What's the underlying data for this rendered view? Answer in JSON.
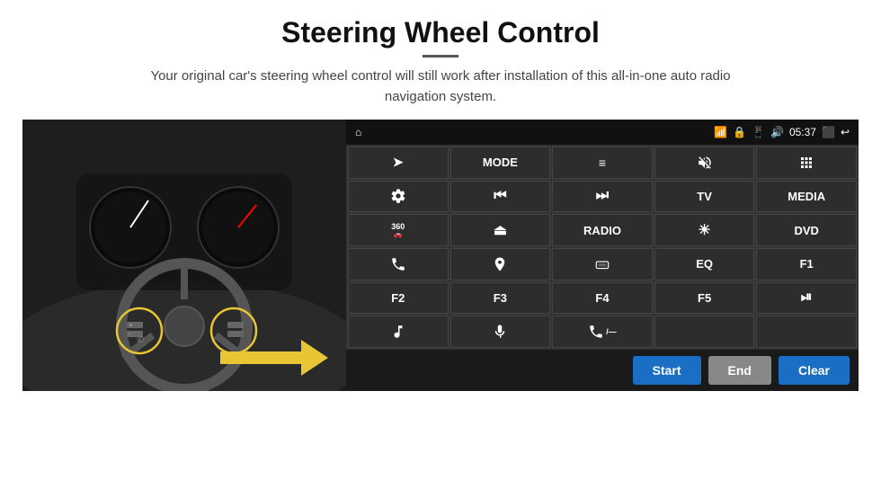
{
  "page": {
    "title": "Steering Wheel Control",
    "subtitle": "Your original car's steering wheel control will still work after installation of this all-in-one auto radio navigation system."
  },
  "status_bar": {
    "time": "05:37",
    "home_icon": "⌂"
  },
  "grid": [
    [
      {
        "type": "icon",
        "icon": "navigate",
        "sym": "➤"
      },
      {
        "type": "text",
        "label": "MODE"
      },
      {
        "type": "icon",
        "icon": "list",
        "sym": "≡"
      },
      {
        "type": "icon",
        "icon": "mute",
        "sym": "🔇"
      },
      {
        "type": "icon",
        "icon": "apps",
        "sym": "⊞"
      }
    ],
    [
      {
        "type": "icon",
        "icon": "settings",
        "sym": "⚙"
      },
      {
        "type": "icon",
        "icon": "rewind",
        "sym": "⏮"
      },
      {
        "type": "icon",
        "icon": "forward",
        "sym": "⏭"
      },
      {
        "type": "text",
        "label": "TV"
      },
      {
        "type": "text",
        "label": "MEDIA"
      }
    ],
    [
      {
        "type": "icon",
        "icon": "360-cam",
        "sym": "360"
      },
      {
        "type": "icon",
        "icon": "eject",
        "sym": "⏏"
      },
      {
        "type": "text",
        "label": "RADIO"
      },
      {
        "type": "icon",
        "icon": "brightness",
        "sym": "☀"
      },
      {
        "type": "text",
        "label": "DVD"
      }
    ],
    [
      {
        "type": "icon",
        "icon": "phone",
        "sym": "☎"
      },
      {
        "type": "icon",
        "icon": "nav-circle",
        "sym": "◎"
      },
      {
        "type": "icon",
        "icon": "mirror",
        "sym": "▭"
      },
      {
        "type": "text",
        "label": "EQ"
      },
      {
        "type": "text",
        "label": "F1"
      }
    ],
    [
      {
        "type": "text",
        "label": "F2"
      },
      {
        "type": "text",
        "label": "F3"
      },
      {
        "type": "text",
        "label": "F4"
      },
      {
        "type": "text",
        "label": "F5"
      },
      {
        "type": "icon",
        "icon": "play-pause",
        "sym": "⏯"
      }
    ],
    [
      {
        "type": "icon",
        "icon": "music",
        "sym": "♪"
      },
      {
        "type": "icon",
        "icon": "mic",
        "sym": "🎤"
      },
      {
        "type": "icon",
        "icon": "phone-call",
        "sym": "📞"
      },
      {
        "type": "empty",
        "label": ""
      },
      {
        "type": "empty",
        "label": ""
      }
    ]
  ],
  "bottom_buttons": {
    "start": "Start",
    "end": "End",
    "clear": "Clear"
  }
}
